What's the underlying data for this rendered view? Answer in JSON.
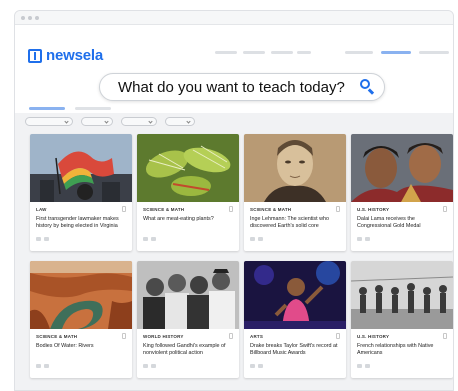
{
  "brand": {
    "name": "newsela",
    "color": "#1f6feb"
  },
  "search": {
    "placeholder": "What do you want to teach today?",
    "icon": "search-icon"
  },
  "cards": [
    {
      "category": "LAW",
      "title": "First transgender lawmaker makes history by being elected in Virginia"
    },
    {
      "category": "SCIENCE & MATH",
      "title": "What are meat-eating plants?"
    },
    {
      "category": "SCIENCE & MATH",
      "title": "Inge Lehmann: The scientist who discovered Earth's solid core"
    },
    {
      "category": "U.S. HISTORY",
      "title": "Dalai Lama receives the Congressional Gold Medal"
    },
    {
      "category": "SCIENCE & MATH",
      "title": "Bodies Of Water: Rivers"
    },
    {
      "category": "WORLD HISTORY",
      "title": "King followed Gandhi's example of nonviolent political action"
    },
    {
      "category": "ARTS",
      "title": "Drake breaks Taylor Swift's record at Billboard Music Awards"
    },
    {
      "category": "U.S. HISTORY",
      "title": "French relationships with Native Americans"
    }
  ]
}
